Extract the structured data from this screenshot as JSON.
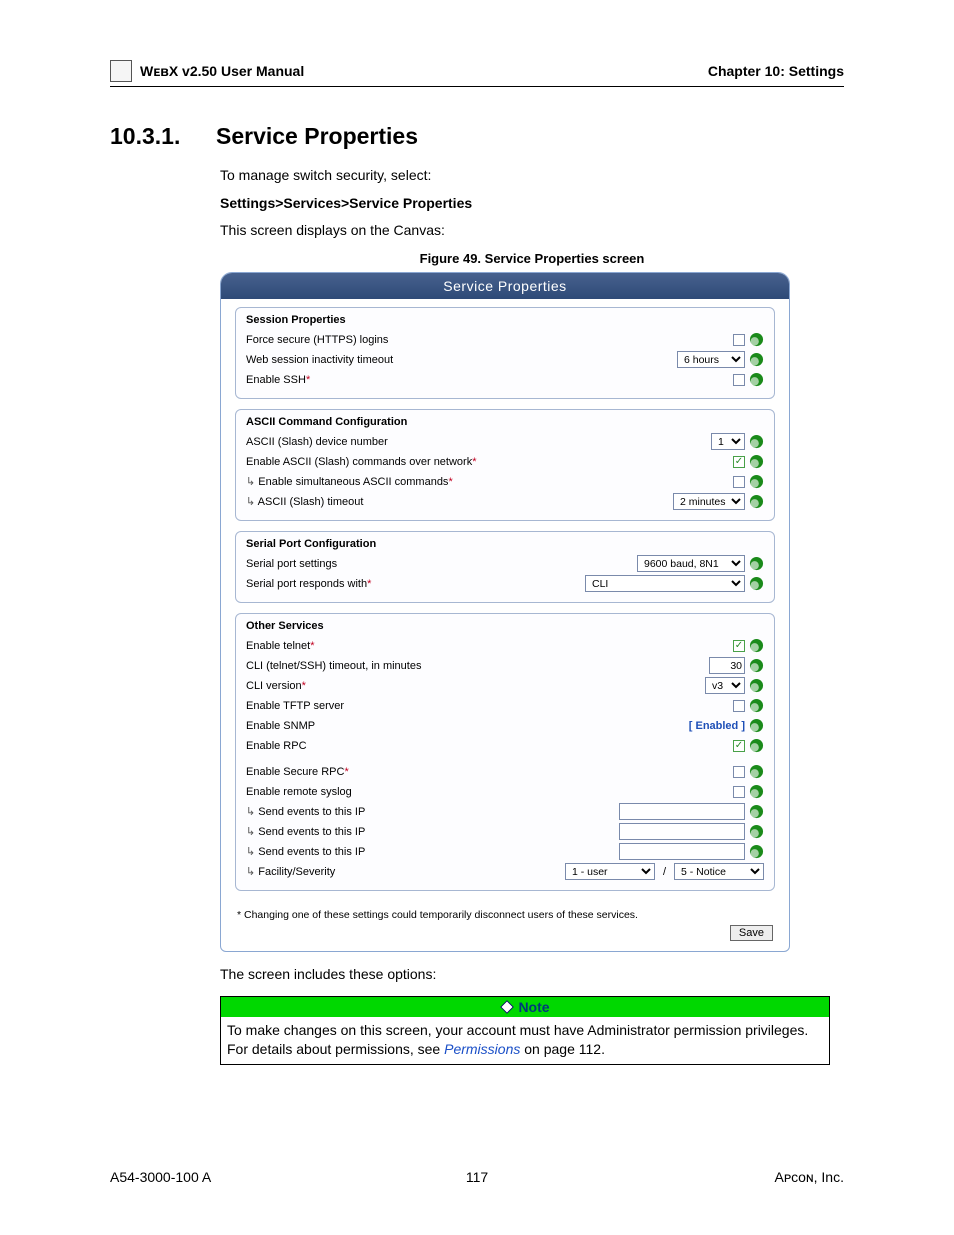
{
  "header": {
    "manual_title": "WᴇʙX v2.50 User Manual",
    "chapter": "Chapter 10: Settings"
  },
  "section": {
    "number": "10.3.1.",
    "title": "Service Properties",
    "intro": "To manage switch security, select:",
    "breadcrumb": "Settings>Services>Service Properties",
    "display_text": "This screen displays on the Canvas:",
    "figure_caption": "Figure 49. Service Properties screen"
  },
  "screenshot": {
    "title": "Service Properties",
    "groups": {
      "session": {
        "title": "Session Properties",
        "force_https": "Force secure (HTTPS) logins",
        "web_timeout_label": "Web session inactivity timeout",
        "web_timeout_value": "6 hours",
        "enable_ssh": "Enable SSH"
      },
      "ascii": {
        "title": "ASCII Command Configuration",
        "device_number_label": "ASCII (Slash) device number",
        "device_number_value": "1",
        "enable_over_net": "Enable ASCII (Slash) commands over network",
        "enable_simul": "Enable simultaneous ASCII commands",
        "timeout_label": "ASCII (Slash) timeout",
        "timeout_value": "2 minutes"
      },
      "serial": {
        "title": "Serial Port Configuration",
        "settings_label": "Serial port settings",
        "settings_value": "9600 baud, 8N1",
        "responds_label": "Serial port responds with",
        "responds_value": "CLI"
      },
      "other": {
        "title": "Other Services",
        "enable_telnet": "Enable telnet",
        "cli_timeout_label": "CLI (telnet/SSH) timeout, in minutes",
        "cli_timeout_value": "30",
        "cli_version_label": "CLI version",
        "cli_version_value": "v3",
        "enable_tftp": "Enable TFTP server",
        "enable_snmp": "Enable SNMP",
        "snmp_status": "[ Enabled ]",
        "enable_rpc": "Enable RPC",
        "enable_secure_rpc": "Enable Secure RPC",
        "enable_syslog": "Enable remote syslog",
        "send_ip": "Send events to this IP",
        "facility_label": "Facility/Severity",
        "facility_value": "1 - user",
        "severity_value": "5 - Notice"
      }
    },
    "footnote": "* Changing one of these settings could temporarily disconnect users of these services.",
    "save_label": "Save"
  },
  "after": {
    "options_text": "The screen includes these options:",
    "note_title": "Note",
    "note_body_1": "To make changes on this screen, your account must have Administrator permission privileges. For details about permissions, see ",
    "note_link": "Permissions",
    "note_body_2": " on page 112."
  },
  "footer": {
    "left": "A54-3000-100 A",
    "center": "117",
    "right": "Aᴘᴄᴏɴ, Inc."
  },
  "glyphs": {
    "check": "✓",
    "asterisk": "*",
    "slash": "/"
  }
}
